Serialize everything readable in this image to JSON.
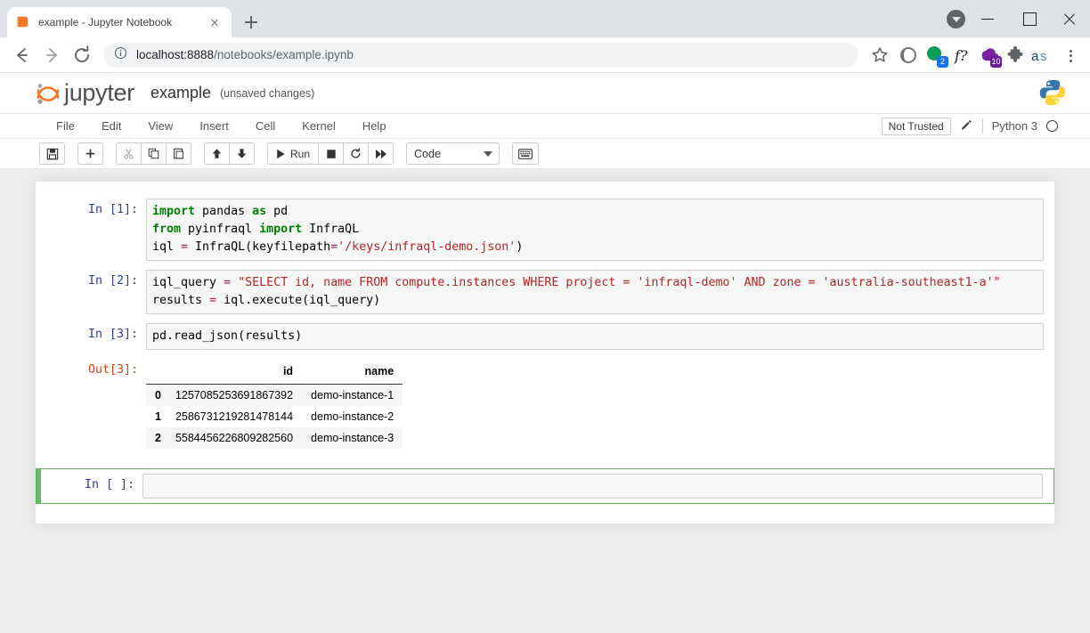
{
  "browser": {
    "tab": {
      "title": "example - Jupyter Notebook",
      "favicon": "jupyter-book-icon"
    },
    "newtab_label": "+",
    "nav": {
      "back": "back-arrow",
      "forward": "forward-arrow",
      "reload": "reload-icon"
    },
    "omnibox": {
      "info_icon": "site-info-icon",
      "url_host": "localhost:8888",
      "url_path": "/notebooks/example.ipynb",
      "star": "bookmark-star-icon"
    },
    "extensions": [
      {
        "name": "moon-extension",
        "badge": ""
      },
      {
        "name": "green-bubble-extension",
        "badge": "2",
        "badge_color": "#1a73e8"
      },
      {
        "name": "function-extension",
        "label": "f?"
      },
      {
        "name": "purple-cloud-extension",
        "badge": "10",
        "badge_color": "#6a1b9a"
      },
      {
        "name": "puzzle-extensions-icon",
        "badge": ""
      },
      {
        "name": "profile-initials",
        "label": "as"
      }
    ],
    "menu": "chrome-menu-icon",
    "window": {
      "minimize": "minimize",
      "maximize": "maximize",
      "close": "close",
      "download": "download-indicator"
    }
  },
  "jupyter": {
    "logo_text": "jupyter",
    "notebook_name": "example",
    "save_status": "(unsaved changes)",
    "menubar": [
      "File",
      "Edit",
      "View",
      "Insert",
      "Cell",
      "Kernel",
      "Help"
    ],
    "trust_status": "Not Trusted",
    "edit_icon": "pencil-icon",
    "kernel_name": "Python 3",
    "kernel_status": "kernel-idle-circle",
    "kernel_logo": "python-logo",
    "toolbar": {
      "save": "💾",
      "insert_below": "✚",
      "cut": "✂",
      "copy": "⧉",
      "paste": "📋",
      "move_up": "↑",
      "move_down": "↓",
      "run_label": "Run",
      "interrupt": "■",
      "restart": "⟳",
      "restart_run_all": "⏩",
      "cell_type": "Code",
      "command_palette": "⌨"
    }
  },
  "cells": [
    {
      "prompt": "In [1]:",
      "type": "code",
      "lines": [
        [
          {
            "t": "import",
            "c": "k"
          },
          {
            "t": " pandas ",
            "c": ""
          },
          {
            "t": "as",
            "c": "k"
          },
          {
            "t": " pd",
            "c": ""
          }
        ],
        [
          {
            "t": "from",
            "c": "k"
          },
          {
            "t": " pyinfraql ",
            "c": ""
          },
          {
            "t": "import",
            "c": "k"
          },
          {
            "t": " InfraQL",
            "c": ""
          }
        ],
        [
          {
            "t": "iql ",
            "c": ""
          },
          {
            "t": "=",
            "c": "op"
          },
          {
            "t": " InfraQL(keyfilepath",
            "c": ""
          },
          {
            "t": "=",
            "c": "op"
          },
          {
            "t": "'/keys/infraql-demo.json'",
            "c": "s"
          },
          {
            "t": ")",
            "c": ""
          }
        ]
      ]
    },
    {
      "prompt": "In [2]:",
      "type": "code",
      "lines": [
        [
          {
            "t": "iql_query ",
            "c": ""
          },
          {
            "t": "=",
            "c": "op"
          },
          {
            "t": " \"SELECT id, name FROM compute.instances WHERE project = 'infraql-demo' AND zone = 'australia-southeast1-a'\"",
            "c": "s"
          }
        ],
        [
          {
            "t": "results ",
            "c": ""
          },
          {
            "t": "=",
            "c": "op"
          },
          {
            "t": " iql.execute(iql_query)",
            "c": ""
          }
        ]
      ]
    },
    {
      "prompt": "In [3]:",
      "type": "code",
      "lines": [
        [
          {
            "t": "pd.read_json(results)",
            "c": ""
          }
        ]
      ]
    }
  ],
  "output": {
    "prompt": "Out[3]:",
    "table": {
      "index_header": "",
      "columns": [
        "id",
        "name"
      ],
      "rows": [
        {
          "index": "0",
          "id": "1257085253691867392",
          "name": "demo-instance-1"
        },
        {
          "index": "1",
          "id": "2586731219281478144",
          "name": "demo-instance-2"
        },
        {
          "index": "2",
          "id": "5584456226809282560",
          "name": "demo-instance-3"
        }
      ]
    }
  },
  "active_cell": {
    "prompt": "In [ ]:",
    "value": "",
    "selected": true
  }
}
